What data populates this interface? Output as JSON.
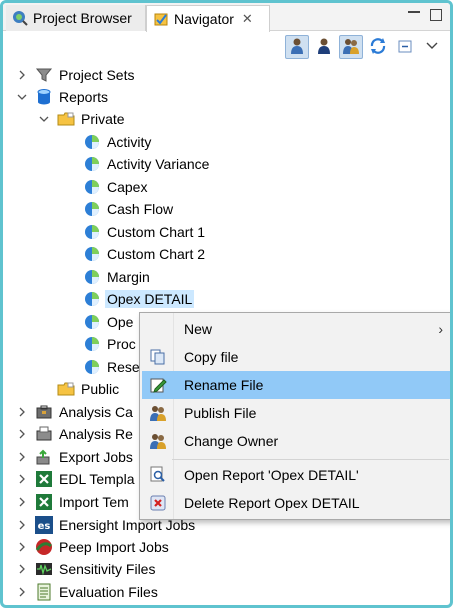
{
  "tabs": [
    {
      "label": "Project Browser",
      "icon": "globe-search-icon"
    },
    {
      "label": "Navigator",
      "icon": "navigator-icon",
      "close": "✕"
    }
  ],
  "tree": {
    "project_sets": "Project Sets",
    "reports": "Reports",
    "private": "Private",
    "reports_items": [
      "Activity",
      "Activity Variance",
      "Capex",
      "Cash Flow",
      "Custom Chart 1",
      "Custom Chart 2",
      "Margin",
      "Opex DETAIL",
      "Ope",
      "Proc",
      "Rese"
    ],
    "public": "Public",
    "others": [
      "Analysis Ca",
      "Analysis Re",
      "Export Jobs",
      "EDL Templa",
      "Import Tem",
      "Enersight Import Jobs",
      "Peep Import Jobs",
      "Sensitivity Files",
      "Evaluation Files"
    ]
  },
  "menu": {
    "new": "New",
    "copy": "Copy file",
    "rename": "Rename File",
    "publish": "Publish File",
    "owner": "Change Owner",
    "open": "Open Report 'Opex DETAIL'",
    "delete": "Delete Report Opex DETAIL"
  },
  "colors": {
    "frame_border": "#5fc3cf",
    "menu_hover": "#91c9f7",
    "selection": "#cce8ff"
  }
}
